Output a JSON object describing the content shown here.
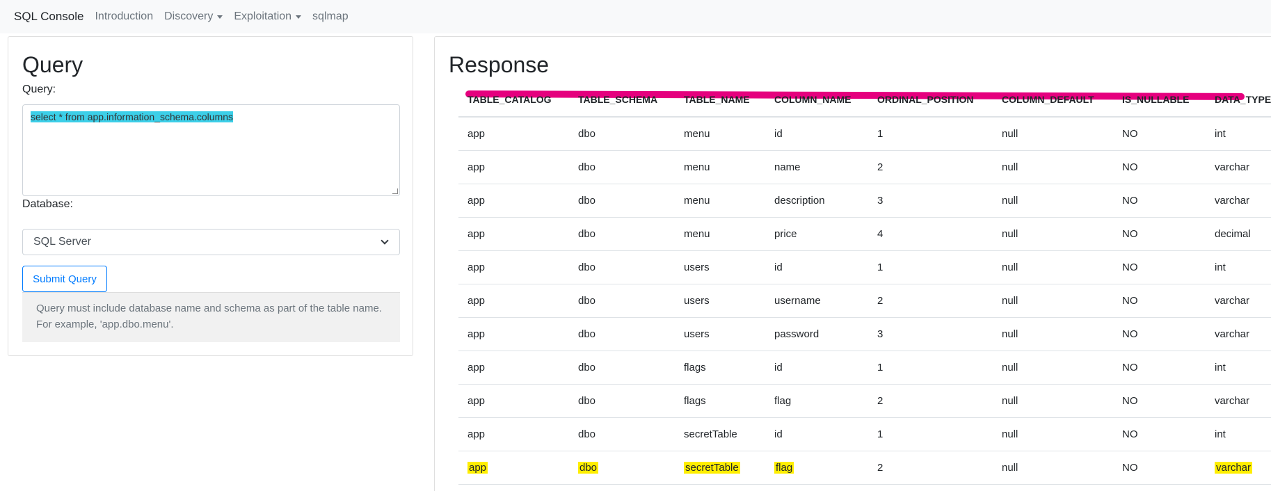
{
  "navbar": {
    "brand": "SQL Console",
    "links": [
      "Introduction",
      "Discovery",
      "Exploitation",
      "sqlmap"
    ]
  },
  "query_panel": {
    "title": "Query",
    "query_label": "Query:",
    "query_value": "select * from app.information_schema.columns",
    "database_label": "Database:",
    "database_selected": "SQL Server",
    "submit_label": "Submit Query",
    "help_text": "Query must include database name and schema as part of the table name. For example, 'app.dbo.menu'."
  },
  "response_panel": {
    "title": "Response",
    "columns": [
      "TABLE_CATALOG",
      "TABLE_SCHEMA",
      "TABLE_NAME",
      "COLUMN_NAME",
      "ORDINAL_POSITION",
      "COLUMN_DEFAULT",
      "IS_NULLABLE",
      "DATA_TYPE"
    ],
    "rows": [
      [
        "app",
        "dbo",
        "menu",
        "id",
        "1",
        "null",
        "NO",
        "int"
      ],
      [
        "app",
        "dbo",
        "menu",
        "name",
        "2",
        "null",
        "NO",
        "varchar"
      ],
      [
        "app",
        "dbo",
        "menu",
        "description",
        "3",
        "null",
        "NO",
        "varchar"
      ],
      [
        "app",
        "dbo",
        "menu",
        "price",
        "4",
        "null",
        "NO",
        "decimal"
      ],
      [
        "app",
        "dbo",
        "users",
        "id",
        "1",
        "null",
        "NO",
        "int"
      ],
      [
        "app",
        "dbo",
        "users",
        "username",
        "2",
        "null",
        "NO",
        "varchar"
      ],
      [
        "app",
        "dbo",
        "users",
        "password",
        "3",
        "null",
        "NO",
        "varchar"
      ],
      [
        "app",
        "dbo",
        "flags",
        "id",
        "1",
        "null",
        "NO",
        "int"
      ],
      [
        "app",
        "dbo",
        "flags",
        "flag",
        "2",
        "null",
        "NO",
        "varchar"
      ],
      [
        "app",
        "dbo",
        "secretTable",
        "id",
        "1",
        "null",
        "NO",
        "int"
      ],
      [
        "app",
        "dbo",
        "secretTable",
        "flag",
        "2",
        "null",
        "NO",
        "varchar"
      ]
    ]
  },
  "colors": {
    "accent": "#007bff",
    "selection": "#3ccfe8",
    "header_annotation": "#e5007e",
    "row_highlight": "#ffee00"
  }
}
